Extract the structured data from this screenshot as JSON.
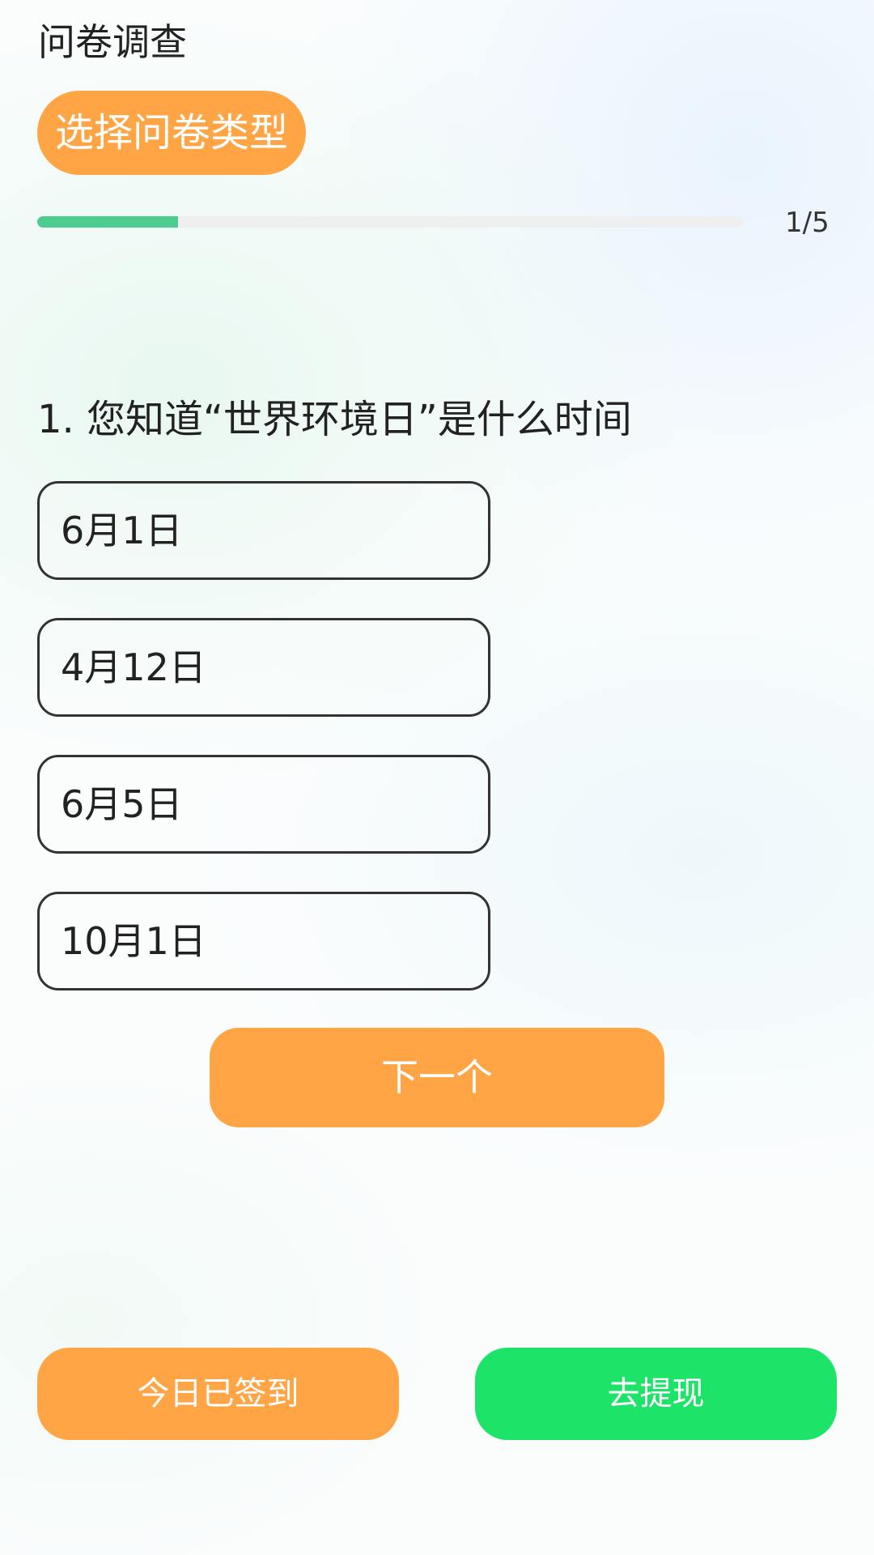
{
  "header": {
    "title": "问卷调查",
    "type_button_label": "选择问卷类型"
  },
  "progress": {
    "current": 1,
    "total": 5,
    "text": "1/5",
    "fraction": 0.2,
    "fill_color": "#4ecb8f",
    "track_color": "#efefef"
  },
  "question": {
    "text": "1. 您知道“世界环境日”是什么时间",
    "options": [
      {
        "label": "6月1日"
      },
      {
        "label": "4月12日"
      },
      {
        "label": "6月5日"
      },
      {
        "label": "10月1日"
      }
    ]
  },
  "actions": {
    "next_label": "下一个",
    "checkin_label": "今日已签到",
    "withdraw_label": "去提现"
  },
  "colors": {
    "accent_orange": "#ffa545",
    "accent_green": "#1de468"
  }
}
